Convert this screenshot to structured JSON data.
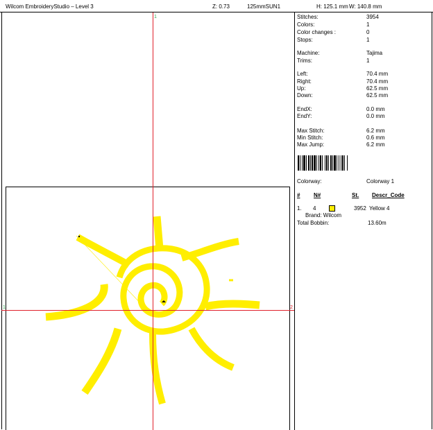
{
  "header": {
    "title": "Wilcom EmbroideryStudio – Level 3",
    "zoom": "Z: 0.73",
    "design_name": "125mmSUN1",
    "height": "H: 125.1 mm",
    "width": "W: 140.8 mm"
  },
  "axes": {
    "top_label": "1",
    "left_label": "1",
    "right_label": "2"
  },
  "stats": [
    {
      "label": "Stitches:",
      "value": "3954"
    },
    {
      "label": "Colors:",
      "value": "1"
    },
    {
      "label": "Color changes :",
      "value": "0"
    },
    {
      "label": "Stops:",
      "value": "1"
    },
    {
      "label": "Machine:",
      "value": "Tajima"
    },
    {
      "label": "Trims:",
      "value": "1"
    },
    {
      "label": "Left:",
      "value": "70.4 mm"
    },
    {
      "label": "Right:",
      "value": "70.4 mm"
    },
    {
      "label": "Up:",
      "value": "62.5 mm"
    },
    {
      "label": "Down:",
      "value": "62.5 mm"
    },
    {
      "label": "EndX:",
      "value": "0.0 mm"
    },
    {
      "label": "EndY:",
      "value": "0.0 mm"
    },
    {
      "label": "Max Stitch:",
      "value": "6.2 mm"
    },
    {
      "label": "Min Stitch:",
      "value": "0.6 mm"
    },
    {
      "label": "Max Jump:",
      "value": "6.2 mm"
    }
  ],
  "colorway": {
    "label": "Colorway:",
    "value": "Colorway 1"
  },
  "table": {
    "headers": {
      "num": "#",
      "needle": "N#",
      "stitches": "St.",
      "descr": "Descr_Code"
    },
    "rows": [
      {
        "num": "1.",
        "needle": "4",
        "stitches": "3952",
        "descr": "Yellow 4",
        "color": "#ffee00"
      }
    ],
    "brand": "Brand: Wilcom",
    "bobbin_label": "Total Bobbin:",
    "bobbin_value": "13.60m"
  },
  "colors": {
    "thread": "#ffee00",
    "axis": "#e0202a",
    "axis_label": "#2fa84f"
  }
}
